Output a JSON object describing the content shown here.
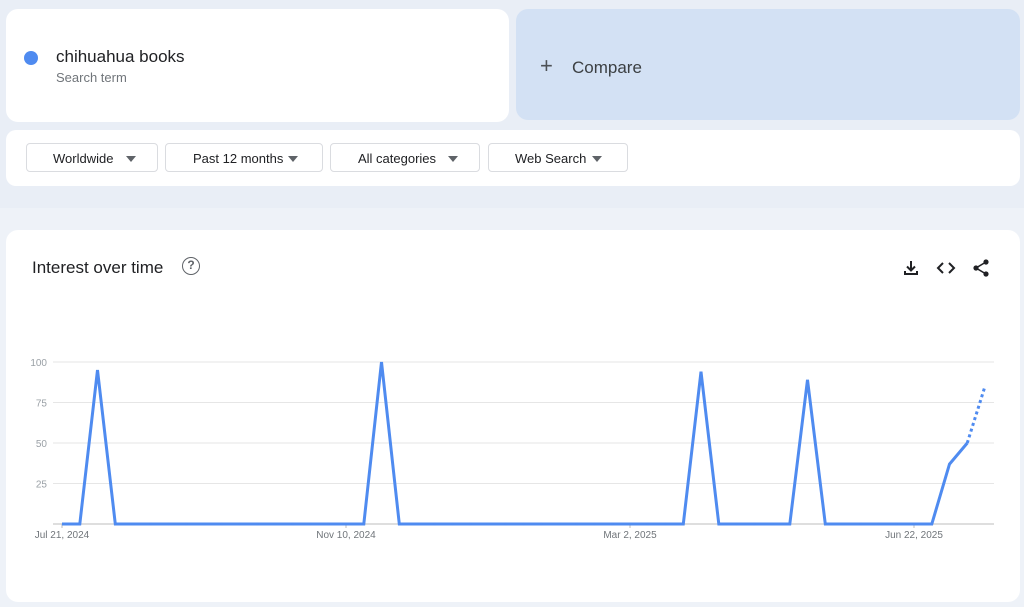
{
  "search_term": {
    "name": "chihuahua books",
    "type_label": "Search term",
    "color": "#4f8bf0"
  },
  "compare": {
    "label": "Compare",
    "icon": "plus-icon"
  },
  "filters": [
    {
      "label": "Worldwide"
    },
    {
      "label": "Past 12 months"
    },
    {
      "label": "All categories"
    },
    {
      "label": "Web Search"
    }
  ],
  "panel": {
    "title": "Interest over time",
    "icons": [
      "help-icon",
      "download-icon",
      "embed-code-icon",
      "share-icon"
    ]
  },
  "chart_data": {
    "type": "line",
    "title": "",
    "xlabel": "",
    "ylabel": "",
    "ylim": [
      0,
      100
    ],
    "yticks": [
      100,
      75,
      50,
      25
    ],
    "x_tick_labels": [
      "Jul 21, 2024",
      "Nov 10, 2024",
      "Mar 2, 2025",
      "Jun 22, 2025"
    ],
    "x_tick_week_index": [
      0,
      16,
      32,
      48
    ],
    "grid": true,
    "line_color": "#4f8bf0",
    "series": [
      {
        "values": [
          0,
          0,
          95,
          0,
          0,
          0,
          0,
          0,
          0,
          0,
          0,
          0,
          0,
          0,
          0,
          0,
          0,
          0,
          100,
          0,
          0,
          0,
          0,
          0,
          0,
          0,
          0,
          0,
          0,
          0,
          0,
          0,
          0,
          0,
          0,
          0,
          94,
          0,
          0,
          0,
          0,
          0,
          89,
          0,
          0,
          0,
          0,
          0,
          0,
          0,
          37,
          50,
          85
        ],
        "partial_last_point": true
      }
    ]
  }
}
